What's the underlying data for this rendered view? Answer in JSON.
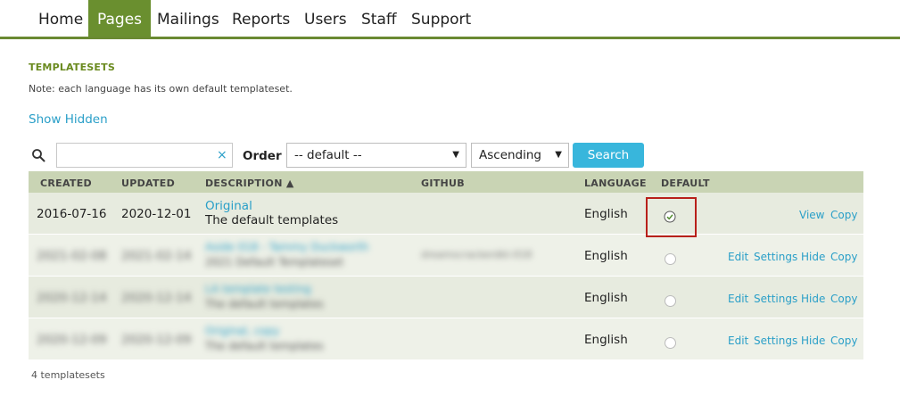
{
  "nav": {
    "items": [
      "Home",
      "Pages",
      "Mailings",
      "Reports",
      "Users",
      "Staff",
      "Support"
    ],
    "active": "Pages"
  },
  "section": {
    "title": "TEMPLATESETS",
    "note": "Note: each language has its own default templateset.",
    "show_hidden": "Show Hidden"
  },
  "filters": {
    "search_value": "",
    "clear_glyph": "×",
    "order_label": "Order",
    "order_value": "-- default --",
    "direction_value": "Ascending",
    "search_button": "Search"
  },
  "table": {
    "headers": {
      "created": "CREATED",
      "updated": "UPDATED",
      "description": "DESCRIPTION ▲",
      "github": "GITHUB",
      "language": "LANGUAGE",
      "default": "DEFAULT"
    },
    "rows": [
      {
        "created": "2016-07-16",
        "updated": "2020-12-01",
        "title": "Original",
        "subtitle": "The default templates",
        "github": "",
        "language": "English",
        "is_default": true,
        "actions": [
          "View",
          "Copy"
        ]
      },
      {
        "created": "2021-02-08",
        "updated": "2021-02-14",
        "title": "Aside 018 - Tammy Duckworth",
        "subtitle": "2021 Default Templateset",
        "github": "dreamscrackerdkt-018",
        "language": "English",
        "is_default": false,
        "actions": [
          "Edit",
          "Settings",
          "Hide",
          "Copy"
        ]
      },
      {
        "created": "2020-12-14",
        "updated": "2020-12-14",
        "title": "LA template testing",
        "subtitle": "The default templates",
        "github": "",
        "language": "English",
        "is_default": false,
        "actions": [
          "Edit",
          "Settings",
          "Hide",
          "Copy"
        ]
      },
      {
        "created": "2020-12-09",
        "updated": "2020-12-09",
        "title": "Original, copy",
        "subtitle": "The default templates",
        "github": "",
        "language": "English",
        "is_default": false,
        "actions": [
          "Edit",
          "Settings",
          "Hide",
          "Copy"
        ]
      }
    ]
  },
  "footer": {
    "count": "4 templatesets"
  },
  "colors": {
    "nav_active": "#6a8f2f",
    "nav_rule": "#6a8a32",
    "link": "#2a9fc8",
    "button": "#38b6dc",
    "header_bg": "#c9d4b4",
    "highlight": "#b8201b"
  }
}
